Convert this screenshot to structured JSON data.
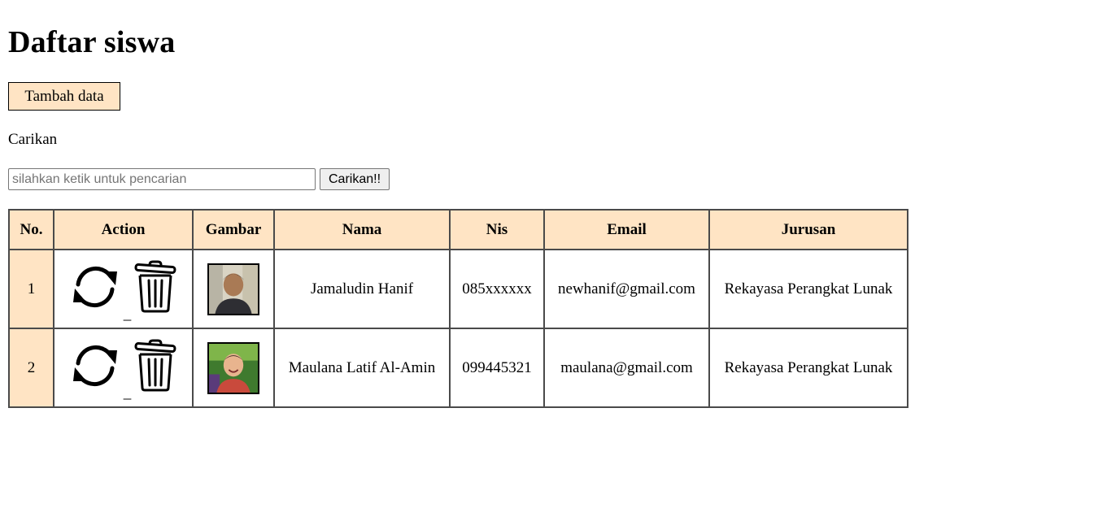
{
  "page": {
    "title": "Daftar siswa"
  },
  "toolbar": {
    "add_label": "Tambah data"
  },
  "search": {
    "label": "Carikan",
    "placeholder": "silahkan ketik untuk pencarian",
    "value": "",
    "button_label": "Carikan!!"
  },
  "table": {
    "headers": [
      "No.",
      "Action",
      "Gambar",
      "Nama",
      "Nis",
      "Email",
      "Jurusan"
    ],
    "action_separator": "_",
    "icons": {
      "edit": "refresh-icon",
      "delete": "trash-icon"
    },
    "rows": [
      {
        "no": "1",
        "nama": "Jamaludin Hanif",
        "nis": "085xxxxxx",
        "email": "newhanif@gmail.com",
        "jurusan": "Rekayasa Perangkat Lunak"
      },
      {
        "no": "2",
        "nama": "Maulana Latif Al-Amin",
        "nis": "099445321",
        "email": "maulana@gmail.com",
        "jurusan": "Rekayasa Perangkat Lunak"
      }
    ]
  },
  "colors": {
    "header_bg": "#ffe4c4",
    "border": "#4a4a4a"
  }
}
